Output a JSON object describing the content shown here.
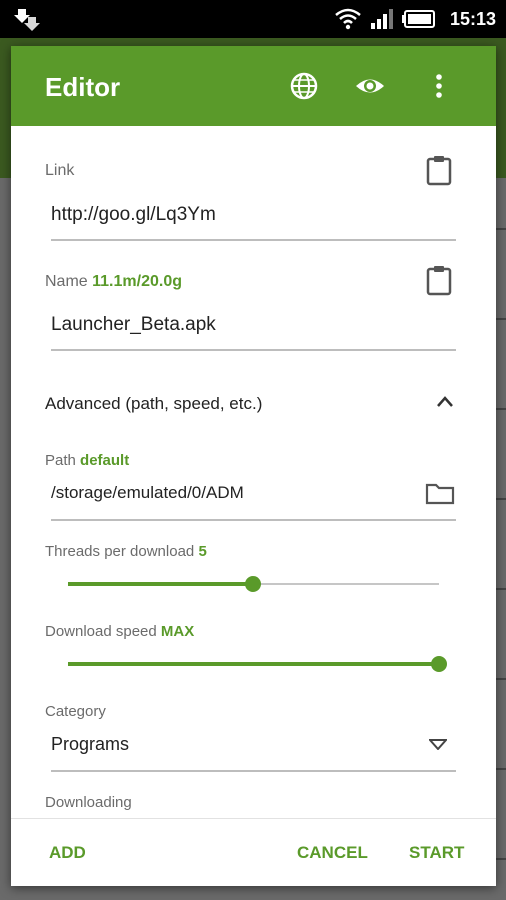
{
  "status_bar": {
    "time": "15:13"
  },
  "dialog": {
    "title": "Editor",
    "link": {
      "label": "Link",
      "value": "http://goo.gl/Lq3Ym"
    },
    "name": {
      "label": "Name",
      "size": "11.1m/20.0g",
      "value": "Launcher_Beta.apk"
    },
    "advanced": {
      "label": "Advanced (path, speed, etc.)"
    },
    "path": {
      "label": "Path",
      "tag": "default",
      "value": "/storage/emulated/0/ADM"
    },
    "threads": {
      "label": "Threads per download",
      "value": "5",
      "level": 0.5
    },
    "speed": {
      "label": "Download speed",
      "value": "MAX",
      "level": 1.0
    },
    "category": {
      "label": "Category",
      "value": "Programs"
    },
    "downloading": {
      "label": "Downloading"
    },
    "buttons": {
      "add": "ADD",
      "cancel": "CANCEL",
      "start": "START"
    }
  },
  "colors": {
    "accent": "#5a9a2a",
    "header": "#5a9a2a"
  },
  "icons": [
    "globe-icon",
    "eye-icon",
    "more-vert-icon",
    "clipboard-icon",
    "folder-icon",
    "chevron-up-icon",
    "dropdown-arrow-icon",
    "wifi-icon",
    "signal-icon",
    "battery-icon",
    "download-icon"
  ]
}
